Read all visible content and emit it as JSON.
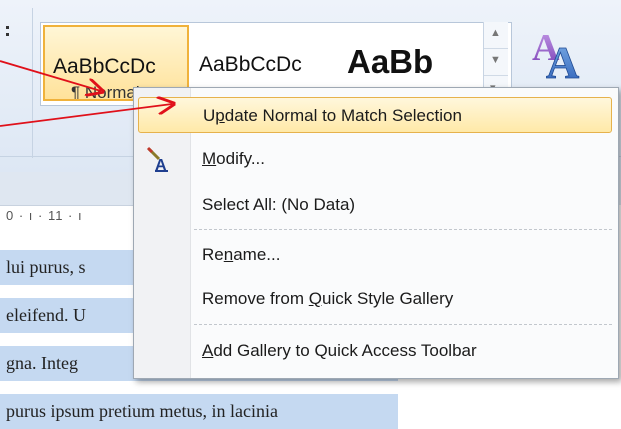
{
  "ribbon": {
    "styles": [
      {
        "sample": "AaBbCcDc",
        "caption": "¶ Normal"
      },
      {
        "sample": "AaBbCcDc"
      },
      {
        "sample": "AaBb"
      }
    ],
    "change_styles_glyph": "A"
  },
  "ruler": {
    "ticks": "0 · ı · 11 · ı"
  },
  "document": {
    "lines": [
      "lui purus, s",
      "eleifend. U",
      "gna. Integ",
      "purus ipsum pretium metus, in lacinia"
    ]
  },
  "menu": {
    "items": [
      {
        "pre": "U",
        "u": "p",
        "post": "date Normal to Match Selection"
      },
      {
        "pre": "",
        "u": "M",
        "post": "odify..."
      },
      {
        "pre": "Select All: (No Data)",
        "u": "",
        "post": ""
      },
      {
        "pre": "Re",
        "u": "n",
        "post": "ame..."
      },
      {
        "pre": "Remove from ",
        "u": "Q",
        "post": "uick Style Gallery"
      },
      {
        "pre": "",
        "u": "A",
        "post": "dd Gallery to Quick Access Toolbar"
      }
    ]
  },
  "colors": {
    "arrow": "#e0101a",
    "highlight_border": "#e6b24c",
    "selection": "#c5d9f1"
  }
}
